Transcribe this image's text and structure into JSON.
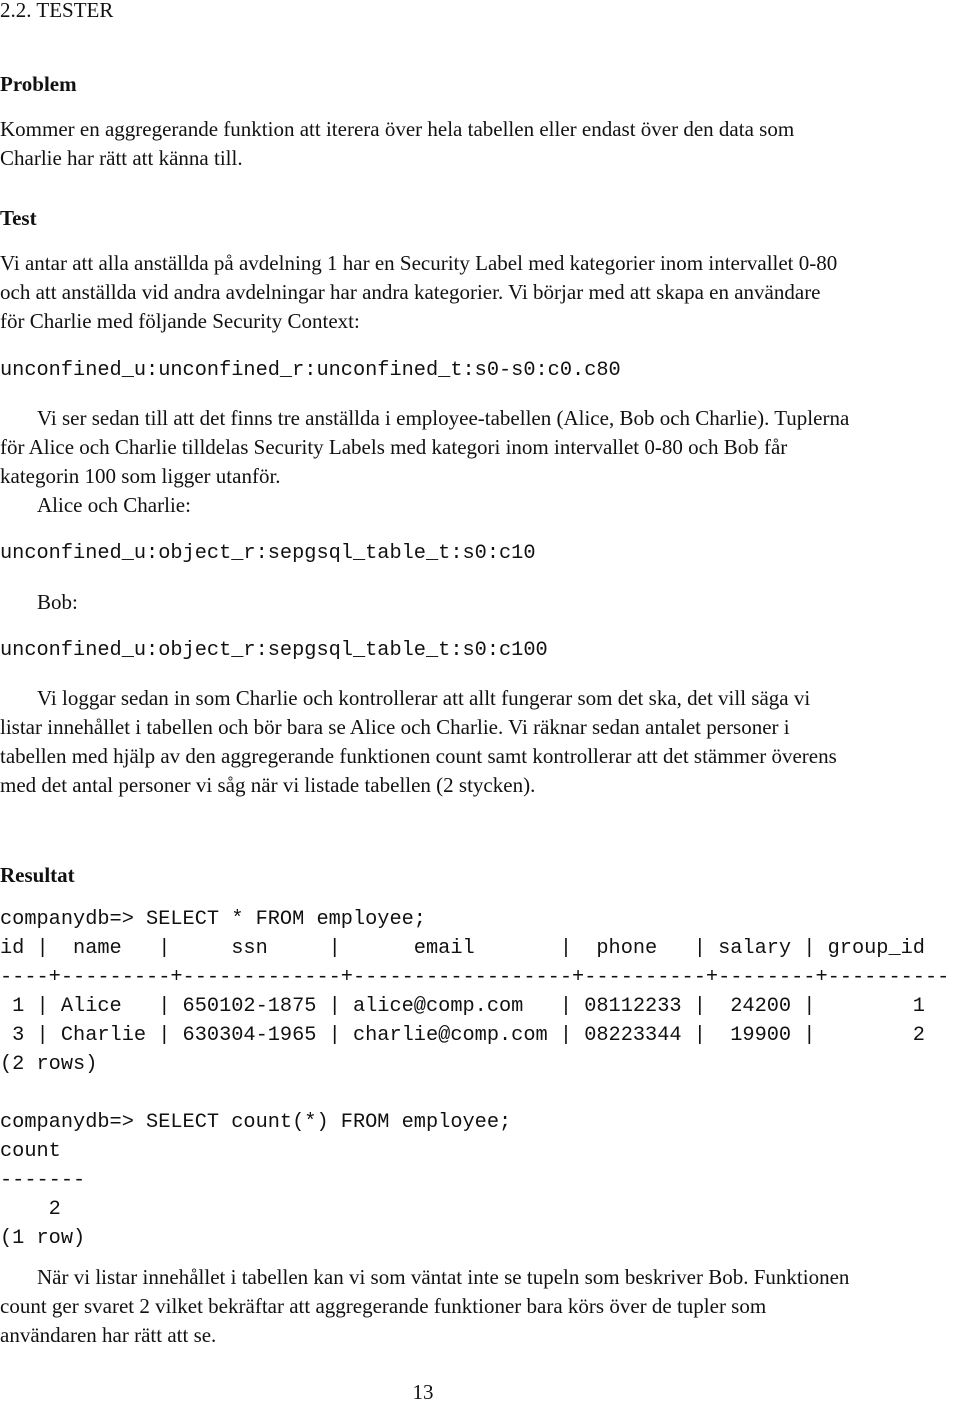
{
  "section_title": "2.2. TESTER",
  "problem": {
    "heading": "Problem",
    "text": "Kommer en aggregerande funktion att iterera över hela tabellen eller endast över den data som Charlie har rätt att känna till."
  },
  "test": {
    "heading": "Test",
    "text": "Vi antar att alla anställda på avdelning 1 har en Security Label med kategorier inom intervallet 0-80 och att anställda vid andra avdelningar har andra kategorier. Vi börjar med att skapa en användare för Charlie med följande Security Context:",
    "context_code": "unconfined_u:unconfined_r:unconfined_t:s0-s0:c0.c80",
    "text2": "Vi ser sedan till att det finns tre anställda i employee-tabellen (Alice, Bob och Charlie). Tuplerna för Alice och Charlie tilldelas Security Labels med kategori inom intervallet 0-80 och Bob får kategorin 100 som ligger utanför.",
    "alice_charlie_label": "Alice och Charlie:",
    "alice_charlie_code": "unconfined_u:object_r:sepgsql_table_t:s0:c10",
    "bob_label": "Bob:",
    "bob_code": "unconfined_u:object_r:sepgsql_table_t:s0:c100",
    "text3": "Vi loggar sedan in som Charlie och kontrollerar att allt fungerar som det ska, det vill säga vi listar innehållet i tabellen och bör bara se Alice och Charlie. Vi räknar sedan antalet personer i tabellen med hjälp av den aggregerande funktionen count samt kontrollerar att det stämmer överens med det antal personer vi såg när vi listade tabellen (2 stycken)."
  },
  "result": {
    "heading": "Resultat",
    "terminal": [
      "companydb=> SELECT * FROM employee;",
      "id |  name   |     ssn     |      email       |  phone   | salary | group_id",
      "----+---------+-------------+------------------+----------+--------+----------",
      " 1 | Alice   | 650102-1875 | alice@comp.com   | 08112233 |  24200 |        1",
      " 3 | Charlie | 630304-1965 | charlie@comp.com | 08223344 |  19900 |        2",
      "(2 rows)",
      "",
      "companydb=> SELECT count(*) FROM employee;",
      "count",
      "-------",
      "    2",
      "(1 row)"
    ],
    "text": "När vi listar innehållet i tabellen kan vi som väntat inte se tupeln som beskriver Bob. Funktionen count ger svaret 2 vilket bekräftar att aggregerande funktioner bara körs över de tupler som användaren har rätt att se."
  },
  "page_number": "13"
}
